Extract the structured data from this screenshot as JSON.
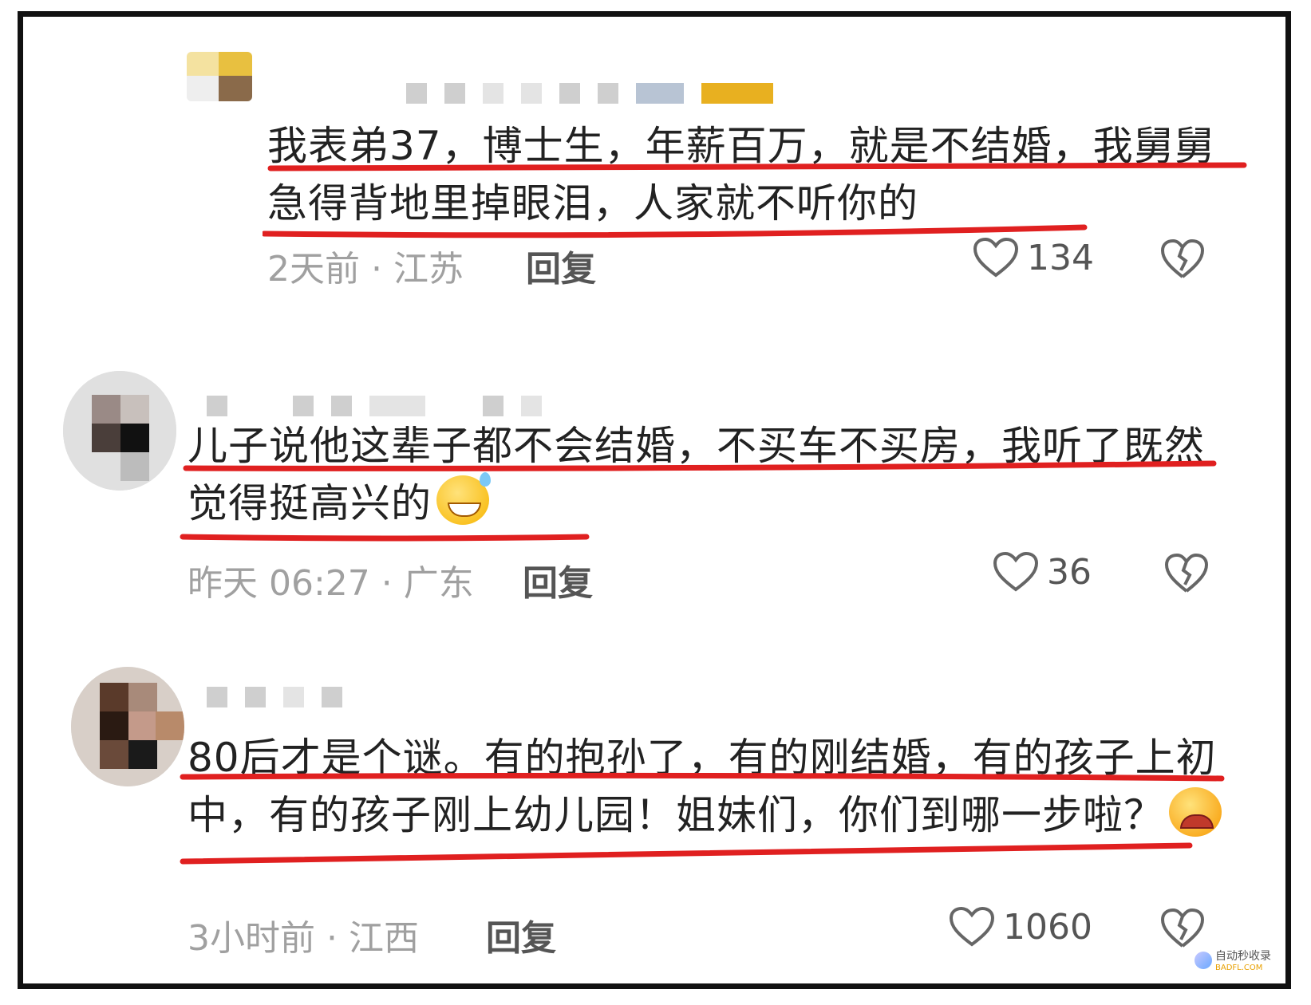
{
  "comments": [
    {
      "text": "我表弟37，博士生，年薪百万，就是不结婚，我舅舅急得背地里掉眼泪，人家就不听你的",
      "time_location": "2天前 · 江苏",
      "reply_label": "回复",
      "likes": "134"
    },
    {
      "text": "儿子说他这辈子都不会结婚，不买车不买房，我听了既然觉得挺高兴的",
      "emoji": "grin-sweat-emoji",
      "time_location": "昨天 06:27 · 广东",
      "reply_label": "回复",
      "likes": "36"
    },
    {
      "text": "80后才是个谜。有的抱孙了，有的刚结婚，有的孩子上初中，有的孩子刚上幼儿园！姐妹们，你们到哪一步啦？",
      "emoji": "crying-face-emoji",
      "time_location": "3小时前 · 江西",
      "reply_label": "回复",
      "likes": "1060"
    }
  ],
  "icons": {
    "like": "heart-outline-icon",
    "dislike": "broken-heart-icon"
  },
  "colors": {
    "underline": "#e02020",
    "text": "#222222",
    "meta": "#a0a0a0"
  },
  "watermark": {
    "text": "自动秒收录",
    "url": "BADFL.COM"
  }
}
